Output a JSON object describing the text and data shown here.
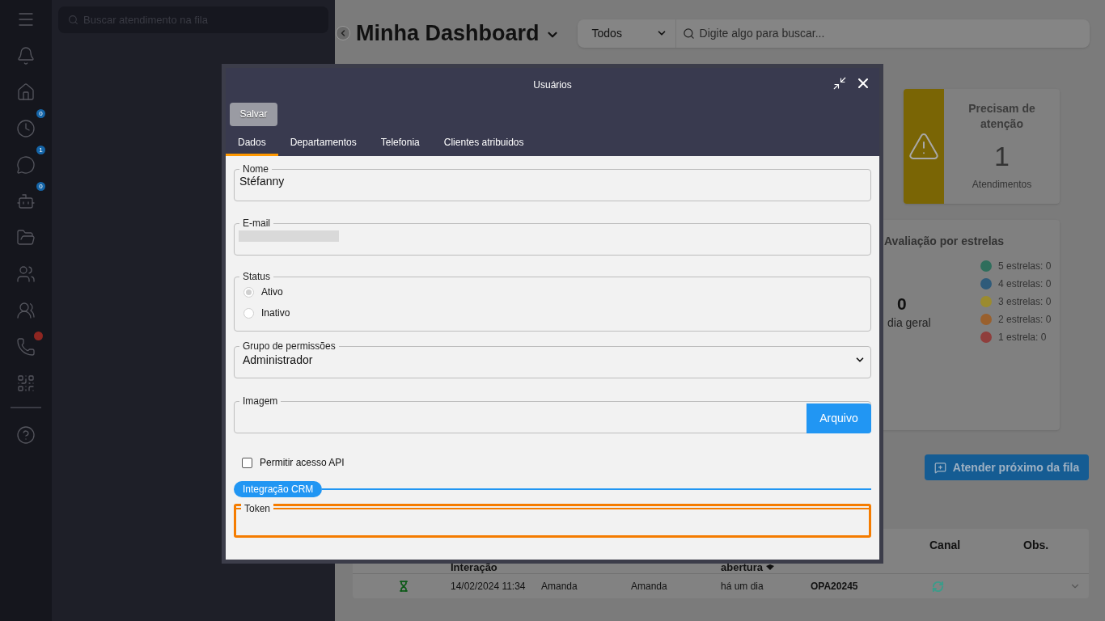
{
  "sidebar": {
    "items": [
      {
        "kind": "menu"
      },
      {
        "kind": "bell"
      },
      {
        "kind": "home"
      },
      {
        "kind": "clock",
        "badge": "0"
      },
      {
        "kind": "chat",
        "badge": "1"
      },
      {
        "kind": "bot",
        "badge": "0"
      },
      {
        "kind": "folder"
      },
      {
        "kind": "users"
      },
      {
        "kind": "group"
      },
      {
        "kind": "phone",
        "alert": true
      },
      {
        "kind": "qr"
      },
      {
        "kind": "help"
      }
    ]
  },
  "queue": {
    "search": {
      "placeholder": "Buscar atendimento na fila"
    }
  },
  "dashboard": {
    "title": "Minha Dashboard",
    "filter": "Todos",
    "search": {
      "placeholder": "Digite algo para buscar..."
    },
    "attention_card": {
      "title": "Precisam de atenção",
      "value": "1",
      "caption": "Atendimentos"
    },
    "stars_card": {
      "title": "Avaliação por estrelas",
      "average": "0",
      "average_label": "dia geral",
      "legend": [
        {
          "label": "5 estrelas: 0",
          "color": "#2f6e5c"
        },
        {
          "label": "4 estrelas: 0",
          "color": "#2f5b7a"
        },
        {
          "label": "3 estrelas: 0",
          "color": "#9b8b2f"
        },
        {
          "label": "2 estrelas: 0",
          "color": "#99602d"
        },
        {
          "label": "1 estrela: 0",
          "color": "#8f3e3c"
        }
      ]
    },
    "next_button": "Atender próximo da fila",
    "table": {
      "columns": [
        "Interação",
        "abertura",
        "Canal",
        "Obs."
      ],
      "rows": [
        {
          "date": "14/02/2024 11:34",
          "agent": "Amanda",
          "column_4": "Amanda",
          "opened": "há um dia",
          "protocol": "OPA20245"
        }
      ]
    }
  },
  "modal": {
    "title": "Usuários",
    "save": "Salvar",
    "tabs": [
      {
        "label": "Dados",
        "selected": true
      },
      {
        "label": "Departamentos",
        "selected": false
      },
      {
        "label": "Telefonia",
        "selected": false
      },
      {
        "label": "Clientes atribuidos",
        "selected": false
      }
    ],
    "name": {
      "label": "Nome",
      "value": "Stéfanny"
    },
    "email": {
      "label": "E-mail"
    },
    "status": {
      "label": "Status",
      "options": [
        {
          "label": "Ativo",
          "selected": true
        },
        {
          "label": "Inativo",
          "selected": false
        }
      ]
    },
    "group": {
      "label": "Grupo de permissões",
      "value": "Administrador"
    },
    "image": {
      "label": "Imagem",
      "button": "Arquivo"
    },
    "api": {
      "label": "Permitir acesso API",
      "checked": false
    },
    "section": "Integração CRM",
    "token": {
      "label": "Token",
      "highlighted": true
    }
  }
}
